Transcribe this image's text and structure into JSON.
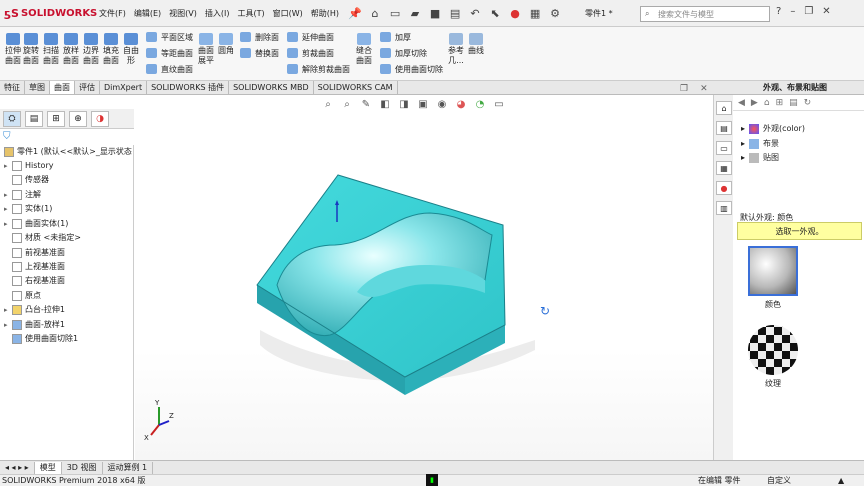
{
  "app": {
    "name": "SOLIDWORKS",
    "document": "零件1 *"
  },
  "menu": [
    "文件(F)",
    "编辑(E)",
    "视图(V)",
    "插入(I)",
    "工具(T)",
    "窗口(W)",
    "帮助(H)"
  ],
  "search": {
    "placeholder": "搜索文件与模型"
  },
  "command_manager": {
    "big_tools": [
      {
        "id": "extrude",
        "label": "拉伸\n曲面"
      },
      {
        "id": "revolve",
        "label": "旋转\n曲面"
      },
      {
        "id": "sweep",
        "label": "扫描\n曲面"
      },
      {
        "id": "loft",
        "label": "放样\n曲面"
      },
      {
        "id": "boundary",
        "label": "边界\n曲面"
      },
      {
        "id": "fill",
        "label": "填充\n曲面"
      },
      {
        "id": "freeform",
        "label": "自由\n形"
      }
    ],
    "col1": [
      "平面区域",
      "等距曲面",
      "直纹曲面"
    ],
    "flatten": "曲面\n展平",
    "round": "圆角",
    "col2": [
      "删除面",
      "替换面"
    ],
    "col3": [
      "延伸曲面",
      "剪裁曲面",
      "解除剪裁曲面"
    ],
    "knit": "缝合\n曲面",
    "col4": [
      "加厚",
      "加厚切除",
      "使用曲面切除"
    ],
    "ref": "参考\n几...",
    "curves": "曲线"
  },
  "tabs": [
    "特征",
    "草图",
    "曲面",
    "评估",
    "DimXpert",
    "SOLIDWORKS 插件",
    "SOLIDWORKS MBD",
    "SOLIDWORKS CAM"
  ],
  "active_tab": "曲面",
  "feature_tree": {
    "root": "零件1 (默认<<默认>_显示状态",
    "nodes": [
      {
        "label": "History",
        "expand": true
      },
      {
        "label": "传感器",
        "expand": false
      },
      {
        "label": "注解",
        "expand": true
      },
      {
        "label": "实体(1)",
        "expand": true
      },
      {
        "label": "曲面实体(1)",
        "expand": true
      },
      {
        "label": "材质 <未指定>",
        "expand": false
      },
      {
        "label": "前视基准面",
        "expand": false
      },
      {
        "label": "上视基准面",
        "expand": false
      },
      {
        "label": "右视基准面",
        "expand": false
      },
      {
        "label": "原点",
        "expand": false
      },
      {
        "label": "凸台-拉伸1",
        "expand": true
      },
      {
        "label": "曲面-放样1",
        "expand": true
      },
      {
        "label": "使用曲面切除1",
        "expand": false
      }
    ]
  },
  "task_pane": {
    "title": "外观、布景和贴图",
    "items": [
      "外观(color)",
      "布景",
      "贴图"
    ],
    "default_label": "默认外观: 颜色",
    "banner": "选取一外观。",
    "swatches": [
      "颜色",
      "纹理"
    ]
  },
  "bottom_tabs": [
    "模型",
    "3D 视图",
    "运动算例 1"
  ],
  "status": {
    "left": "SOLIDWORKS Premium 2018 x64 版",
    "mode": "在编辑 零件",
    "custom": "自定义",
    "caret": "▲"
  },
  "colors": {
    "model_top": "#3ed2d6",
    "model_side": "#28a6b0",
    "accent": "#3a6fd8",
    "banner": "#ffffa0"
  }
}
